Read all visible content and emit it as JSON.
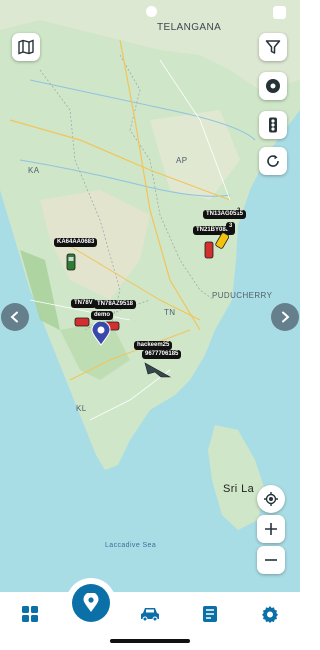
{
  "map": {
    "region_labels": {
      "telangana": "TELANGANA",
      "ap": "AP",
      "ka": "KA",
      "tn": "TN",
      "kl": "KL",
      "puducherry": "PUDUCHERRY",
      "laccadive": "Laccadive Sea",
      "srilanka": "Sri La"
    },
    "vehicles": [
      {
        "label": "KA64AA0683",
        "color": "green",
        "icon": "car-icon"
      },
      {
        "label": "TN13AG0515",
        "badge": "2",
        "color": "yellow",
        "icon": "car-icon"
      },
      {
        "label": "TN21BY0889",
        "extra": "3",
        "color": "red",
        "icon": "car-icon"
      },
      {
        "label": "TN78V",
        "color": "red",
        "icon": "car-icon"
      },
      {
        "label": "TN78AZ9518",
        "color": "red",
        "icon": "car-icon"
      },
      {
        "label": "demo",
        "color": "blue",
        "icon": "location-pin-icon"
      },
      {
        "label": "hackeem25",
        "color": "gray",
        "icon": "plane-icon"
      },
      {
        "label": "9677706185",
        "color": "gray",
        "icon": "plane-icon"
      }
    ]
  },
  "controls": {
    "left": [
      "map-layers-icon"
    ],
    "right": [
      "filter-icon",
      "record-icon",
      "traffic-light-icon",
      "refresh-icon"
    ],
    "zoom": [
      "my-location-icon",
      "zoom-in-icon",
      "zoom-out-icon"
    ]
  },
  "bottom_nav": {
    "items": [
      "dashboard-icon",
      "location-pin-icon",
      "car-icon",
      "report-icon",
      "settings-icon"
    ],
    "active": "location-pin-icon",
    "accent": "#0b6fa8"
  }
}
